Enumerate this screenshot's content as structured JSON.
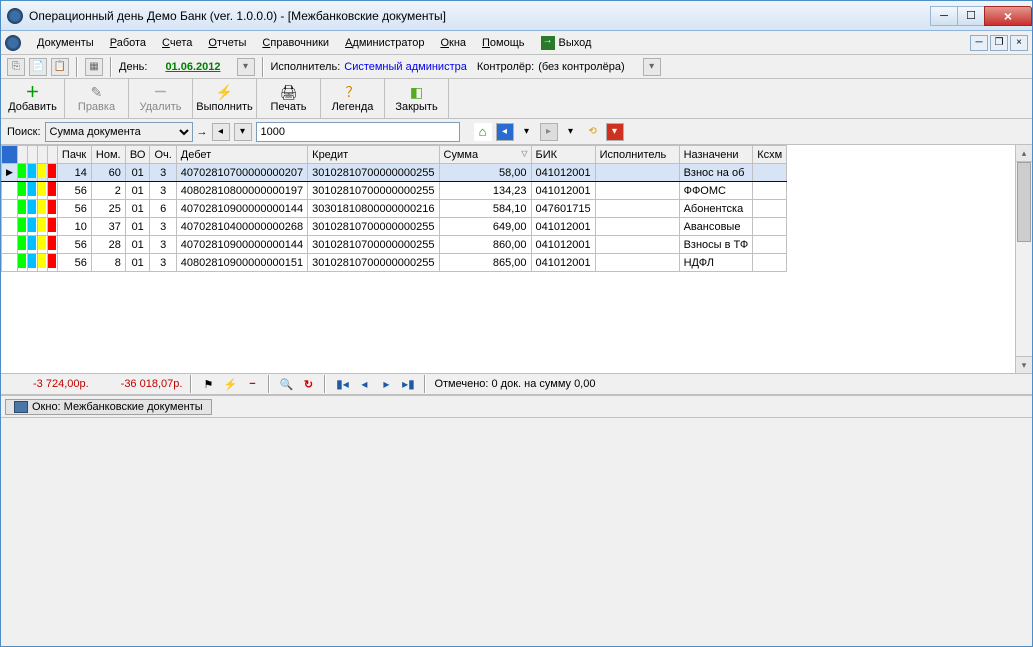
{
  "window": {
    "title": "Операционный день Демо Банк (ver. 1.0.0.0) - [Межбанковские документы]"
  },
  "menu": {
    "items": [
      "Документы",
      "Работа",
      "Счета",
      "Отчеты",
      "Справочники",
      "Администратор",
      "Окна",
      "Помощь"
    ],
    "exit": "Выход"
  },
  "infobar": {
    "day_label": "День:",
    "date": "01.06.2012",
    "performer_label": "Исполнитель:",
    "performer": "Системный администра",
    "controller_label": "Контролёр:",
    "controller": "(без контролёра)"
  },
  "toolbar": {
    "add": "Добавить",
    "edit": "Правка",
    "delete": "Удалить",
    "execute": "Выполнить",
    "print": "Печать",
    "legend": "Легенда",
    "close": "Закрыть"
  },
  "search": {
    "label": "Поиск:",
    "field": "Сумма документа",
    "value": "1000"
  },
  "grid": {
    "headers": {
      "pack": "Пачк",
      "nom": "Ном.",
      "vo": "ВО",
      "och": "Оч.",
      "debit": "Дебет",
      "credit": "Кредит",
      "sum": "Сумма",
      "bik": "БИК",
      "performer": "Исполнитель",
      "purpose": "Назначени",
      "ksxm": "Ксхм"
    },
    "rows": [
      {
        "colors": [
          "#00ff00",
          "#00c0ff",
          "#ffff00",
          "#ff0000"
        ],
        "pack": "14",
        "nom": "60",
        "vo": "01",
        "och": "3",
        "debit": "40702810700000000207",
        "credit": "30102810700000000255",
        "sum": "58,00",
        "bik": "041012001",
        "purpose": "Взнос на об",
        "sel": true
      },
      {
        "colors": [
          "#00ff00",
          "#00c0ff",
          "#ffff00",
          "#ff0000"
        ],
        "pack": "56",
        "nom": "2",
        "vo": "01",
        "och": "3",
        "debit": "40802810800000000197",
        "credit": "30102810700000000255",
        "sum": "134,23",
        "bik": "041012001",
        "purpose": "ФФОМС"
      },
      {
        "colors": [
          "#00ff00",
          "#00c0ff",
          "#ffff00",
          "#ff0000"
        ],
        "pack": "56",
        "nom": "25",
        "vo": "01",
        "och": "6",
        "debit": "40702810900000000144",
        "credit": "30301810800000000216",
        "sum": "584,10",
        "bik": "047601715",
        "purpose": "Абонентска"
      },
      {
        "colors": [
          "#00ff00",
          "#00c0ff",
          "#ffff00",
          "#ff0000"
        ],
        "pack": "10",
        "nom": "37",
        "vo": "01",
        "och": "3",
        "debit": "40702810400000000268",
        "credit": "30102810700000000255",
        "sum": "649,00",
        "bik": "041012001",
        "purpose": "Авансовые"
      },
      {
        "colors": [
          "#00ff00",
          "#00c0ff",
          "#ffff00",
          "#ff0000"
        ],
        "pack": "56",
        "nom": "28",
        "vo": "01",
        "och": "3",
        "debit": "40702810900000000144",
        "credit": "30102810700000000255",
        "sum": "860,00",
        "bik": "041012001",
        "purpose": "Взносы в ТФ"
      },
      {
        "colors": [
          "#00ff00",
          "#00c0ff",
          "#ffff00",
          "#ff0000"
        ],
        "pack": "56",
        "nom": "8",
        "vo": "01",
        "och": "3",
        "debit": "40802810900000000151",
        "credit": "30102810700000000255",
        "sum": "865,00",
        "bik": "041012001",
        "purpose": "НДФЛ"
      }
    ]
  },
  "sumbar": {
    "sum1": "-3 724,00р.",
    "sum2": "-36 018,07р.",
    "selected": "Отмечено: 0 док. на сумму 0,00"
  },
  "statusbar": {
    "window_tab": "Окно: Межбанковские документы"
  }
}
